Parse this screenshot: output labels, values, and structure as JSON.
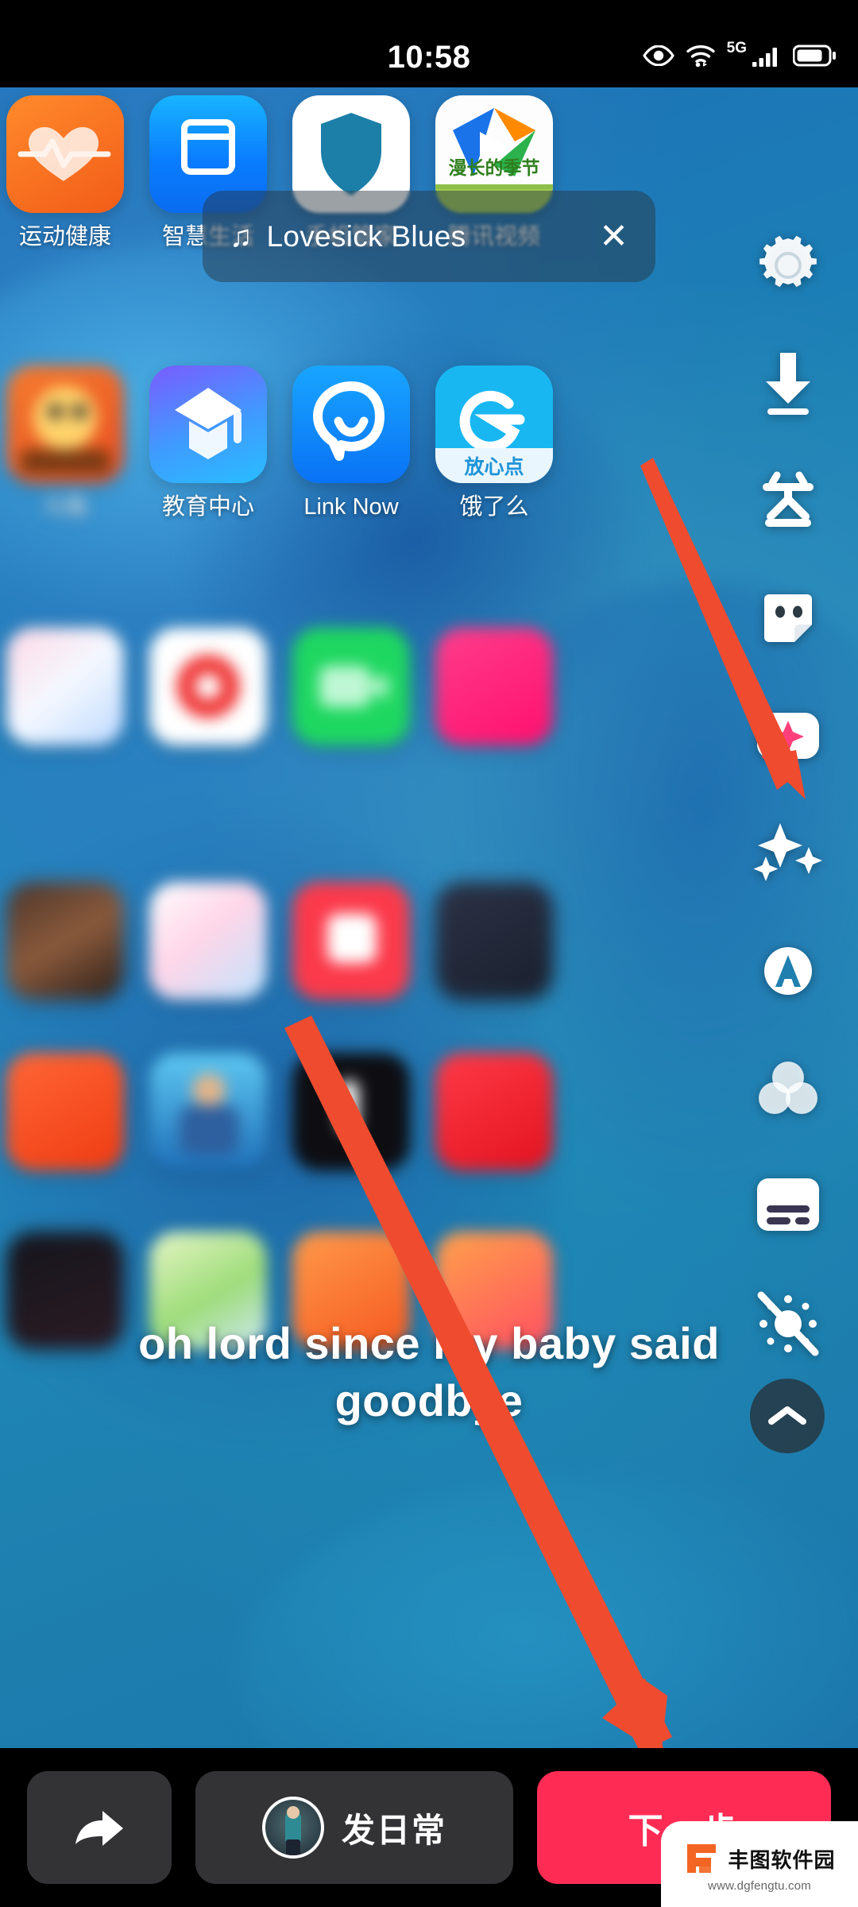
{
  "status_bar": {
    "time": "10:58",
    "icons": [
      "eye-comfort-icon",
      "wifi-icon",
      "signal-icon",
      "battery-icon"
    ],
    "network_label": "5G"
  },
  "now_playing": {
    "music_note_icon": "♫",
    "title": "Lovesick Blues",
    "close_label": "✕"
  },
  "caption": {
    "text": "oh lord since my baby said goodbye"
  },
  "home_screen": {
    "apps": [
      {
        "label": "运动健康",
        "icon": "health-app-icon"
      },
      {
        "label": "智慧生活",
        "icon": "smart-life-app-icon"
      },
      {
        "label": "手机管家",
        "icon": "phone-manager-app-icon"
      },
      {
        "label": "腾讯视频",
        "icon": "tencent-video-app-icon"
      },
      {
        "label": "斗鱼",
        "icon": "douyu-app-icon"
      },
      {
        "label": "教育中心",
        "icon": "education-center-app-icon"
      },
      {
        "label": "Link Now",
        "icon": "link-now-app-icon"
      },
      {
        "label": "饿了么",
        "icon": "eleme-app-icon"
      }
    ]
  },
  "tool_rail": {
    "items": [
      {
        "name": "settings-gear-icon",
        "label": "设置"
      },
      {
        "name": "download-icon",
        "label": "下载"
      },
      {
        "name": "text-icon",
        "label": "文字"
      },
      {
        "name": "sticker-icon",
        "label": "贴纸"
      },
      {
        "name": "beauty-icon",
        "label": "美颜"
      },
      {
        "name": "effects-sparkle-icon",
        "label": "特效"
      },
      {
        "name": "auto-enhance-icon",
        "label": "自动"
      },
      {
        "name": "filter-icon",
        "label": "滤镜"
      },
      {
        "name": "captions-icon",
        "label": "字幕"
      },
      {
        "name": "flash-off-icon",
        "label": "闪光灯关"
      }
    ],
    "collapse_icon": "chevron-up-icon"
  },
  "bottom_bar": {
    "share_icon": "share-arrow-icon",
    "daily_label": "发日常",
    "next_label": "下一步",
    "next_color": "#FE2C55"
  },
  "watermark": {
    "site_name": "丰图软件园",
    "url": "www.dgfengtu.com",
    "logo_color": "#F26522"
  },
  "annotations": {
    "arrow_color": "#EE4B2F",
    "arrows": [
      "arrow-to-effects-button",
      "arrow-to-next-button"
    ]
  }
}
